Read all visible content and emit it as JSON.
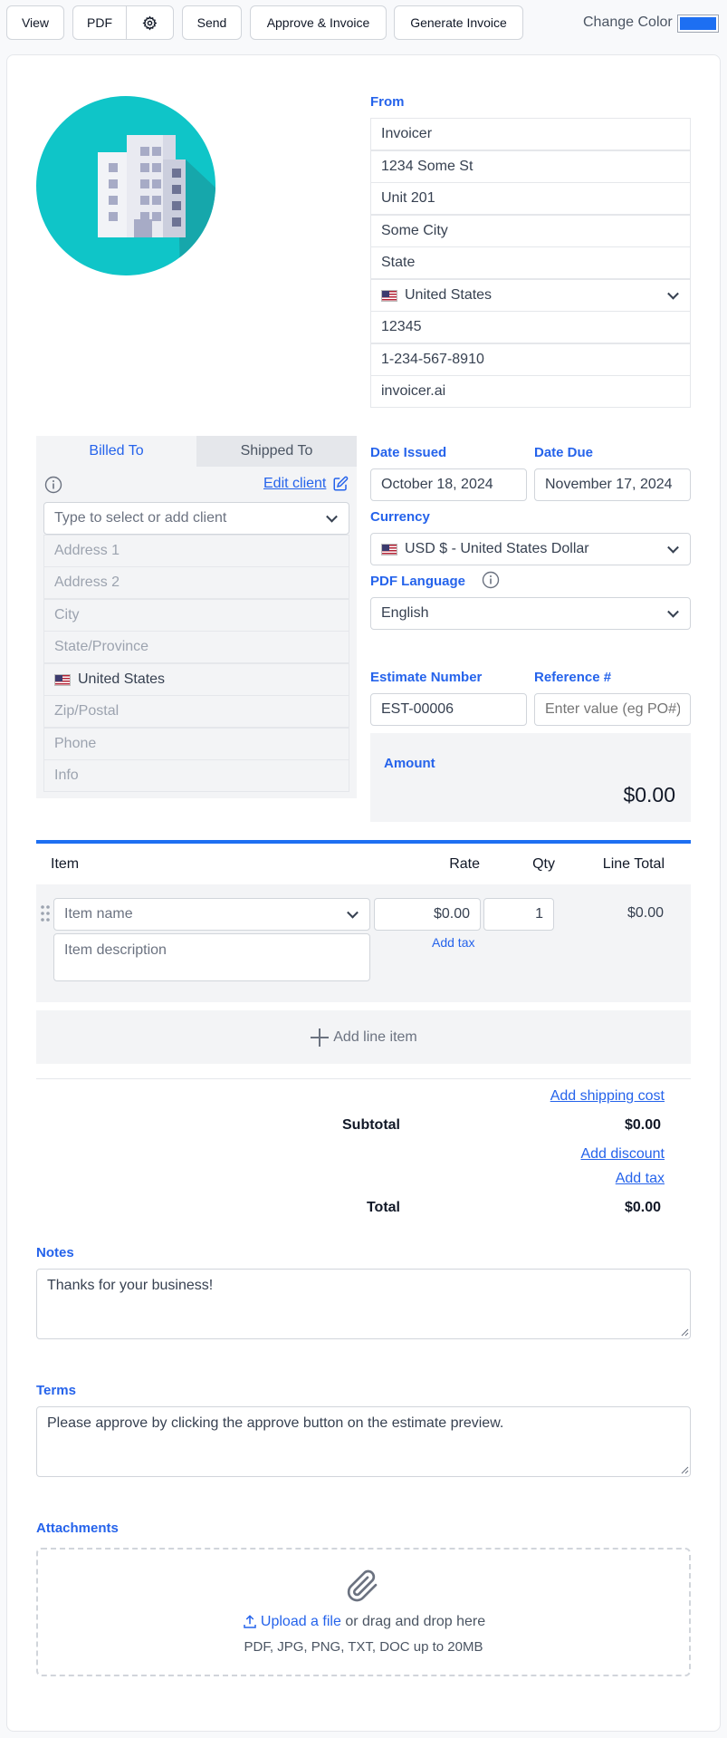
{
  "toolbar": {
    "view": "View",
    "pdf": "PDF",
    "settings_icon": "gear-icon",
    "send": "Send",
    "approve_invoice": "Approve & Invoice",
    "generate_invoice": "Generate Invoice",
    "change_color": "Change Color",
    "color_value": "#1d6ff2"
  },
  "from": {
    "label": "From",
    "name": "Invoicer",
    "address1": "1234 Some St",
    "address2": "Unit 201",
    "city": "Some City",
    "state": "State",
    "country": "United States",
    "zip": "12345",
    "phone": "1-234-567-8910",
    "website": "invoicer.ai"
  },
  "client": {
    "tab_billed": "Billed To",
    "tab_shipped": "Shipped To",
    "edit_client": "Edit client",
    "select_placeholder": "Type to select or add client",
    "address1": "Address 1",
    "address2": "Address 2",
    "city": "City",
    "state": "State/Province",
    "country": "United States",
    "zip": "Zip/Postal",
    "phone": "Phone",
    "info": "Info"
  },
  "details": {
    "date_issued_label": "Date Issued",
    "date_issued": "October 18, 2024",
    "date_due_label": "Date Due",
    "date_due": "November 17, 2024",
    "currency_label": "Currency",
    "currency": "USD $ - United States Dollar",
    "pdf_language_label": "PDF Language",
    "pdf_language": "English",
    "estimate_number_label": "Estimate Number",
    "estimate_number": "EST-00006",
    "reference_label": "Reference #",
    "reference_placeholder": "Enter value (eg PO#)",
    "amount_label": "Amount",
    "amount": "$0.00"
  },
  "items": {
    "headers": {
      "item": "Item",
      "rate": "Rate",
      "qty": "Qty",
      "line_total": "Line Total"
    },
    "row": {
      "name_placeholder": "Item name",
      "description_placeholder": "Item description",
      "rate": "$0.00",
      "qty": "1",
      "add_tax": "Add tax",
      "line_total": "$0.00"
    },
    "add_line_item": "Add line item"
  },
  "totals": {
    "add_shipping": "Add shipping cost",
    "subtotal_label": "Subtotal",
    "subtotal": "$0.00",
    "add_discount": "Add discount",
    "add_tax": "Add tax",
    "total_label": "Total",
    "total": "$0.00"
  },
  "notes": {
    "label": "Notes",
    "value": "Thanks for your business!"
  },
  "terms": {
    "label": "Terms",
    "value": "Please approve by clicking the approve button on the estimate preview."
  },
  "attachments": {
    "label": "Attachments",
    "upload_link": "Upload a file",
    "upload_text": "or drag and drop here",
    "formats": "PDF, JPG, PNG, TXT, DOC up to 20MB"
  }
}
